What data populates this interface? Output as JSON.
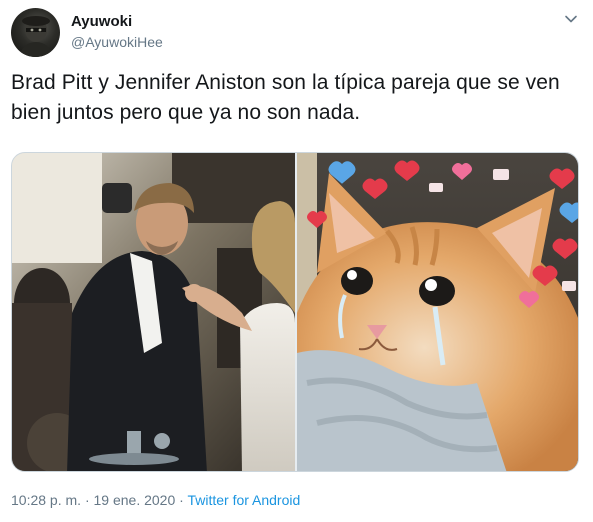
{
  "author": {
    "display_name": "Ayuwoki",
    "handle": "@AyuwokiHee",
    "avatar_icon": "masked-figure-avatar"
  },
  "menu": {
    "icon": "chevron-down-icon"
  },
  "tweet": {
    "text": "Brad Pitt y Jennifer Aniston son la típica pareja que se ven bien juntos pero que ya no son nada."
  },
  "media": {
    "left_photo": "couple-photo",
    "right_photo": "crying-cat-with-hearts"
  },
  "meta": {
    "time": "10:28 p. m.",
    "separator": "·",
    "date": "19 ene. 2020",
    "source": "Twitter for Android"
  },
  "colors": {
    "text": "#14171a",
    "muted": "#657786",
    "link": "#1b95e0",
    "border": "#ccd6dd"
  }
}
